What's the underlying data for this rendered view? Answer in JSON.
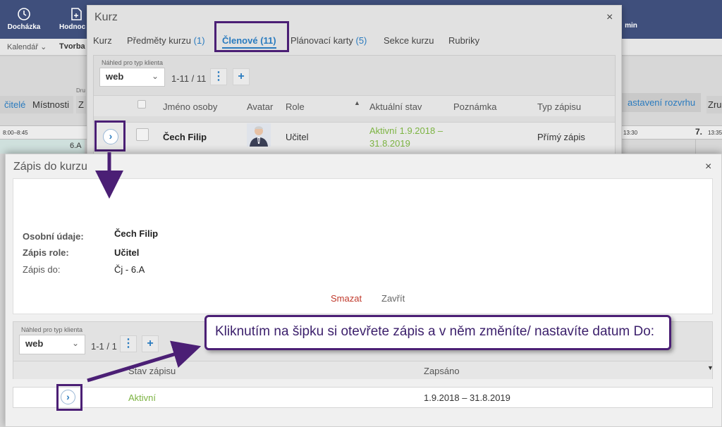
{
  "app": {
    "topnav": [
      {
        "label": "Docházka",
        "icon": "clock-icon"
      },
      {
        "label": "Hodnoc",
        "icon": "grade-sheet-icon"
      },
      {
        "label": "min",
        "icon": ""
      }
    ],
    "subnav": [
      "Kalendář",
      "Tvorba r"
    ],
    "bg_buttons": [
      "čitelé",
      "Místnosti",
      "Z",
      "astavení rozvrhu",
      "Zru"
    ],
    "bg_timeslots": [
      "8:00–8:45",
      "13:30",
      "13:35"
    ],
    "bg_day_label": "7.",
    "bg_class": "6.A",
    "bg_drop_label": "Dru"
  },
  "kurz_modal": {
    "title": "Kurz",
    "tabs": [
      {
        "label": "Kurz",
        "count": ""
      },
      {
        "label": "Předměty kurzu",
        "count": "(1)"
      },
      {
        "label": "Členové",
        "count": "(11)",
        "active": true
      },
      {
        "label": "Plánovací karty",
        "count": "(5)"
      },
      {
        "label": "Sekce kurzu",
        "count": ""
      },
      {
        "label": "Rubriky",
        "count": ""
      }
    ],
    "client_label": "Náhled pro typ klienta",
    "client_value": "web",
    "pagination": "1-11 / 11",
    "columns": [
      "Jméno osoby",
      "Avatar",
      "Role",
      "Aktuální stav",
      "Poznámka",
      "Typ zápisu"
    ],
    "row": {
      "name": "Čech Filip",
      "role": "Učitel",
      "status_line1": "Aktivní 1.9.2018 –",
      "status_line2": "31.8.2019",
      "type": "Přímý zápis"
    }
  },
  "zapis_modal": {
    "title": "Zápis do kurzu",
    "fields": [
      {
        "label": "Osobní údaje:",
        "value": "Čech Filip"
      },
      {
        "label": "Zápis role:",
        "value": "Učitel"
      },
      {
        "label": "Zápis do:",
        "value": "Čj - 6.A"
      }
    ],
    "delete_label": "Smazat",
    "close_label": "Zavřít",
    "client_label": "Náhled pro typ klienta",
    "client_value": "web",
    "pagination": "1-1 / 1",
    "columns": [
      "Stav zápisu",
      "Zapsáno"
    ],
    "row": {
      "status": "Aktivní",
      "date": "1.9.2018 – 31.8.2019"
    }
  },
  "annotation": {
    "callout_text": "Kliknutím na šipku si otevřete zápis a v něm změníte/ nastavíte datum Do:"
  },
  "colors": {
    "topbar": "#3f4f7c",
    "accent_blue": "#2a7bbf",
    "status_green": "#7cb342",
    "delete_red": "#c0392b",
    "annotation_purple": "#4b1f75"
  }
}
